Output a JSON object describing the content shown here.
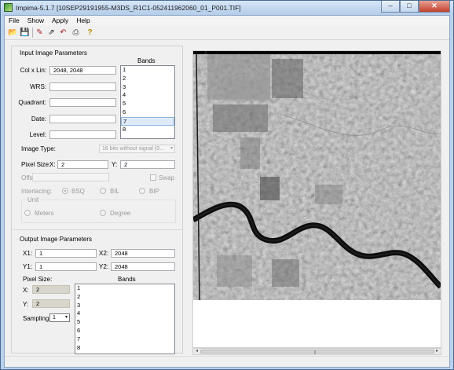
{
  "window": {
    "title": "Impima-5.1.7 [10SEP29191955-M3DS_R1C1-052411962060_01_P001.TIF]",
    "minimize_glyph": "–",
    "maximize_glyph": "□",
    "close_glyph": "✕"
  },
  "menu": [
    "File",
    "Show",
    "Apply",
    "Help"
  ],
  "toolbar": {
    "icons": [
      "open-folder-icon",
      "save-icon",
      "pencil-icon",
      "export-icon",
      "undo-icon",
      "print-icon",
      "help-icon"
    ],
    "glyphs": [
      "📂",
      "💾",
      "✎",
      "⇗",
      "↶",
      "⎙",
      "?"
    ]
  },
  "input": {
    "section_title": "Input Image Parameters",
    "col_lin_label": "Col x Lin:",
    "col_lin_value": "2048, 2048",
    "wrs_label": "WRS:",
    "wrs_value": "",
    "quadrant_label": "Quadrant:",
    "quadrant_value": "",
    "date_label": "Date:",
    "date_value": "",
    "level_label": "Level:",
    "level_value": "",
    "bands_label": "Bands",
    "bands": [
      "1",
      "2",
      "3",
      "4",
      "5",
      "6",
      "7",
      "8"
    ],
    "selected_band": "7",
    "image_type_label": "Image Type:",
    "image_type_value": "16 bits without signal (0...",
    "pixel_size_label": "Pixel Size:",
    "x_label": "X:",
    "x_value": "2",
    "y_label": "Y:",
    "y_value": "2",
    "offset_label": "Offset:",
    "offset_value": "",
    "swap_label": "Swap",
    "interlacing_label": "Interlacing:",
    "interlacing_options": [
      "BSQ",
      "BIL",
      "BIP"
    ],
    "interlacing_selected": "BSQ",
    "unit_label": "Unit",
    "unit_options": [
      "Meters",
      "Degree"
    ]
  },
  "output": {
    "section_title": "Output Image Parameters",
    "x1_label": "X1:",
    "x1_value": "1",
    "x2_label": "X2:",
    "x2_value": "2048",
    "y1_label": "Y1:",
    "y1_value": "1",
    "y2_label": "Y2:",
    "y2_value": "2048",
    "pixel_size_label": "Pixel Size:",
    "x_label": "X:",
    "x_value": "2",
    "y_label": "Y:",
    "y_value": "2",
    "bands_label": "Bands",
    "bands": [
      "1",
      "2",
      "3",
      "4",
      "5",
      "6",
      "7",
      "8"
    ],
    "sampling_label": "Sampling",
    "sampling_value": "1"
  },
  "scroll": {
    "left_glyph": "◂",
    "right_glyph": "▸",
    "grip_glyph": "|||"
  }
}
